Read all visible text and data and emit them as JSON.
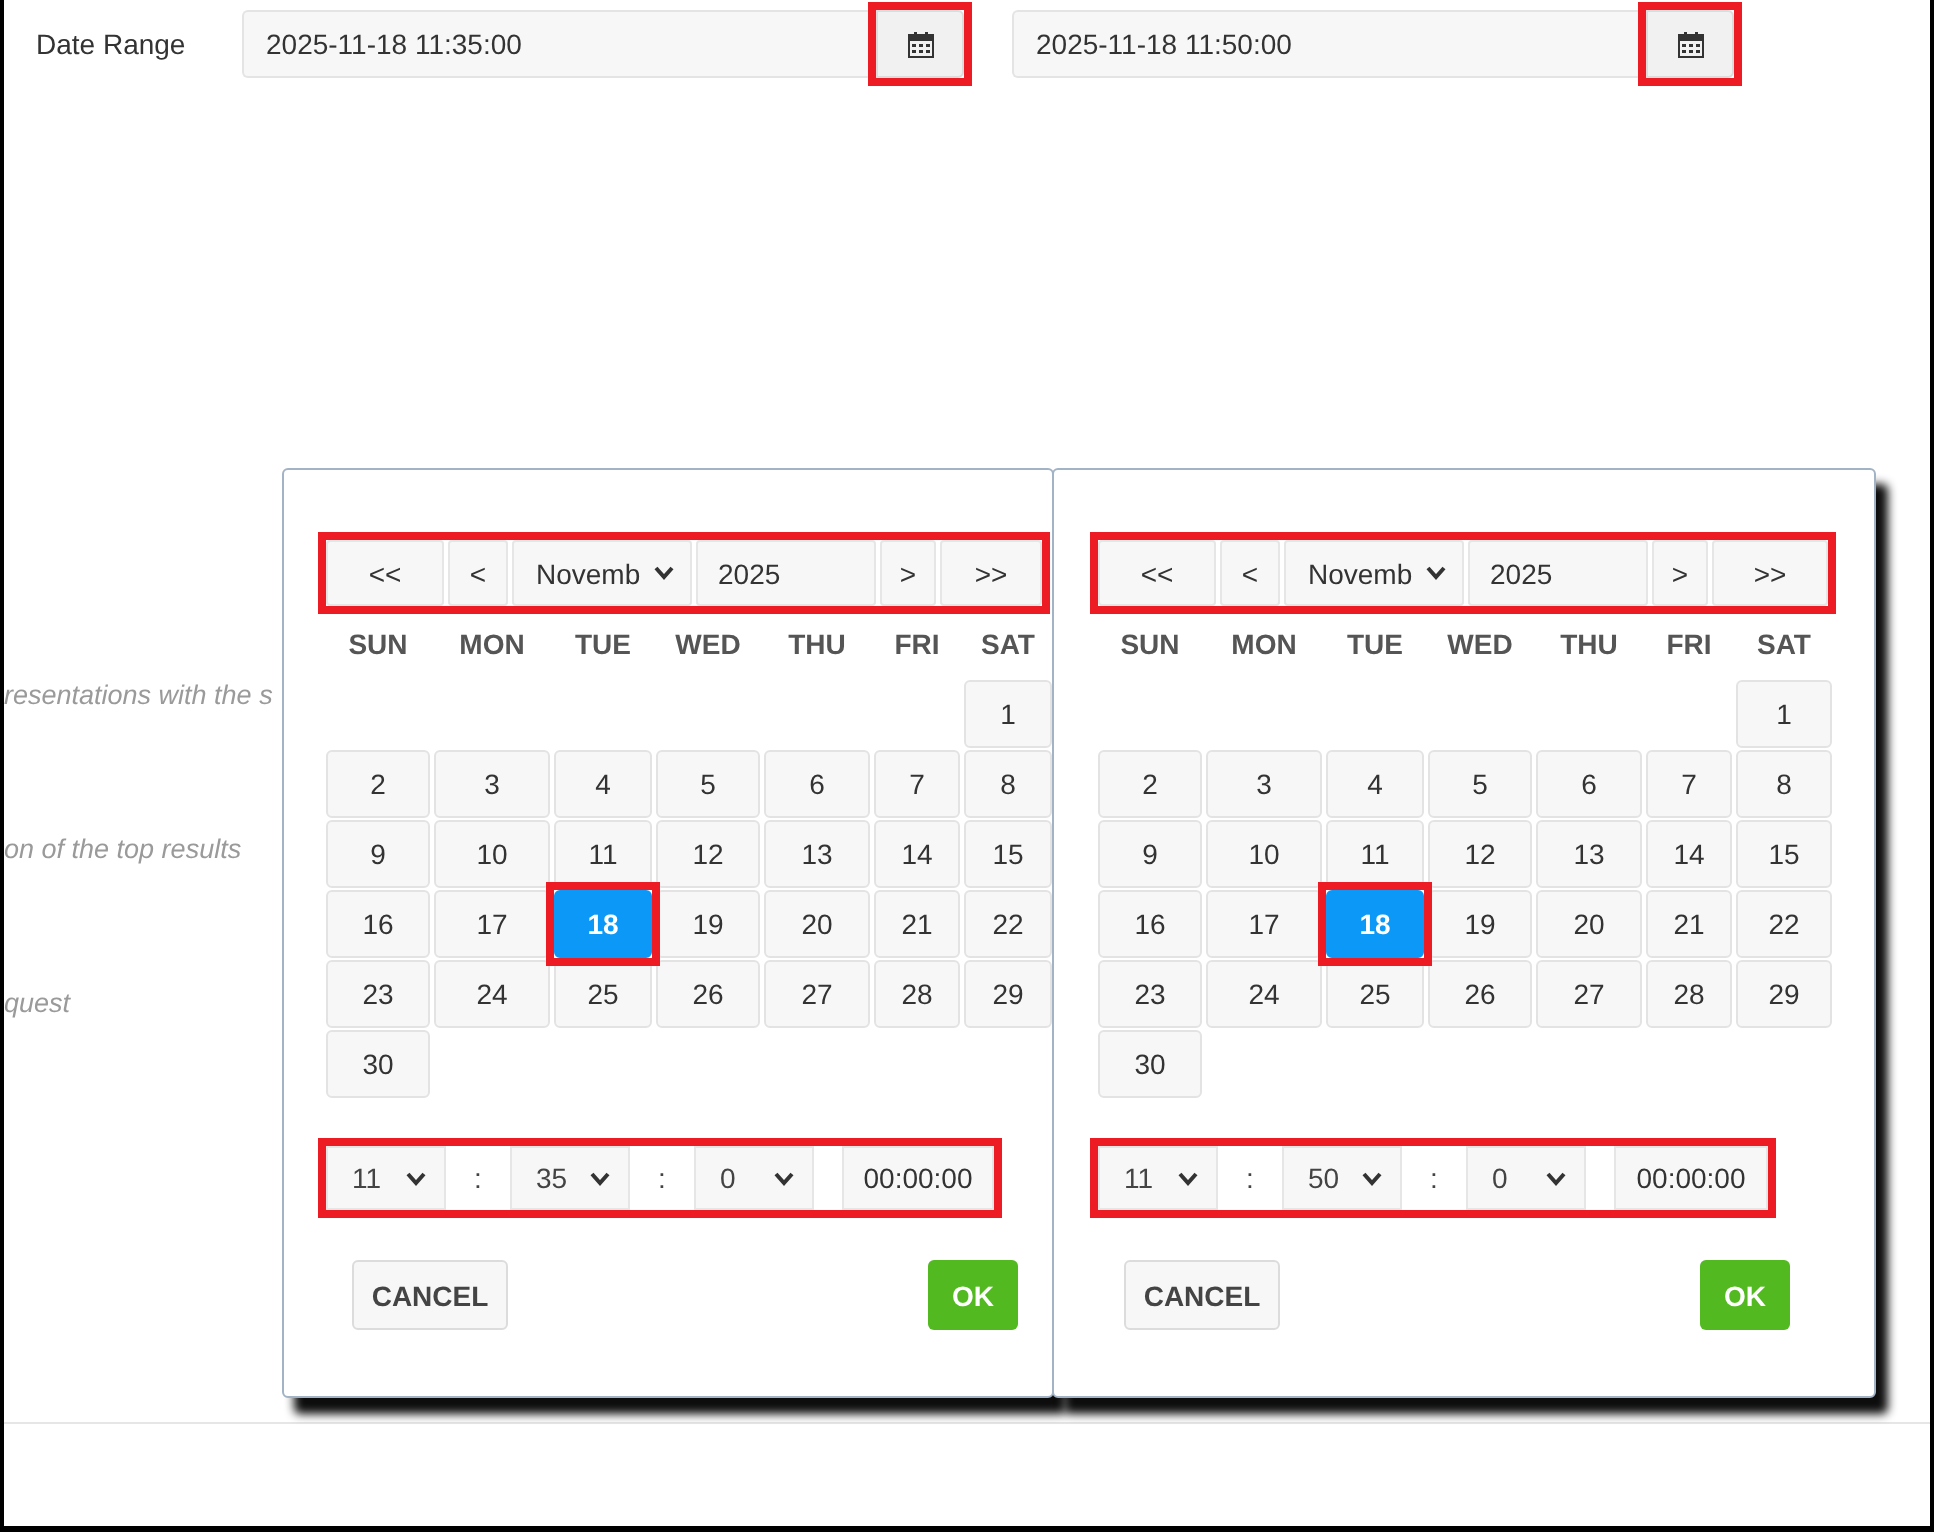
{
  "date_range": {
    "label": "Date Range",
    "fields": [
      {
        "value": "2025-11-18 11:35:00",
        "button_highlighted": true
      },
      {
        "value": "2025-11-18 11:50:00",
        "button_highlighted": true
      }
    ]
  },
  "background_notes": [
    "resentations with the s",
    "on of the top results",
    "quest"
  ],
  "pickers": [
    {
      "nav": {
        "prev_year": "<<",
        "prev_month": "<",
        "month": "Novemb",
        "year": "2025",
        "next_month": ">",
        "next_year": ">>",
        "highlighted": true
      },
      "weekdays": [
        "SUN",
        "MON",
        "TUE",
        "WED",
        "THU",
        "FRI",
        "SAT"
      ],
      "days": [
        {
          "kind": "blank"
        },
        {
          "kind": "blank"
        },
        {
          "kind": "blank"
        },
        {
          "kind": "blank"
        },
        {
          "kind": "blank"
        },
        {
          "kind": "blank"
        },
        {
          "kind": "day",
          "label": "1",
          "selected": false,
          "highlighted": false
        },
        {
          "kind": "day",
          "label": "2",
          "selected": false,
          "highlighted": false
        },
        {
          "kind": "day",
          "label": "3",
          "selected": false,
          "highlighted": false
        },
        {
          "kind": "day",
          "label": "4",
          "selected": false,
          "highlighted": false
        },
        {
          "kind": "day",
          "label": "5",
          "selected": false,
          "highlighted": false
        },
        {
          "kind": "day",
          "label": "6",
          "selected": false,
          "highlighted": false
        },
        {
          "kind": "day",
          "label": "7",
          "selected": false,
          "highlighted": false
        },
        {
          "kind": "day",
          "label": "8",
          "selected": false,
          "highlighted": false
        },
        {
          "kind": "day",
          "label": "9",
          "selected": false,
          "highlighted": false
        },
        {
          "kind": "day",
          "label": "10",
          "selected": false,
          "highlighted": false
        },
        {
          "kind": "day",
          "label": "11",
          "selected": false,
          "highlighted": false
        },
        {
          "kind": "day",
          "label": "12",
          "selected": false,
          "highlighted": false
        },
        {
          "kind": "day",
          "label": "13",
          "selected": false,
          "highlighted": false
        },
        {
          "kind": "day",
          "label": "14",
          "selected": false,
          "highlighted": false
        },
        {
          "kind": "day",
          "label": "15",
          "selected": false,
          "highlighted": false
        },
        {
          "kind": "day",
          "label": "16",
          "selected": false,
          "highlighted": false
        },
        {
          "kind": "day",
          "label": "17",
          "selected": false,
          "highlighted": false
        },
        {
          "kind": "day",
          "label": "18",
          "selected": true,
          "highlighted": true
        },
        {
          "kind": "day",
          "label": "19",
          "selected": false,
          "highlighted": false
        },
        {
          "kind": "day",
          "label": "20",
          "selected": false,
          "highlighted": false
        },
        {
          "kind": "day",
          "label": "21",
          "selected": false,
          "highlighted": false
        },
        {
          "kind": "day",
          "label": "22",
          "selected": false,
          "highlighted": false
        },
        {
          "kind": "day",
          "label": "23",
          "selected": false,
          "highlighted": false
        },
        {
          "kind": "day",
          "label": "24",
          "selected": false,
          "highlighted": false
        },
        {
          "kind": "day",
          "label": "25",
          "selected": false,
          "highlighted": false
        },
        {
          "kind": "day",
          "label": "26",
          "selected": false,
          "highlighted": false
        },
        {
          "kind": "day",
          "label": "27",
          "selected": false,
          "highlighted": false
        },
        {
          "kind": "day",
          "label": "28",
          "selected": false,
          "highlighted": false
        },
        {
          "kind": "day",
          "label": "29",
          "selected": false,
          "highlighted": false
        },
        {
          "kind": "day",
          "label": "30",
          "selected": false,
          "highlighted": false
        }
      ],
      "time": {
        "hour": "11",
        "separator_1": ":",
        "minute": "35",
        "separator_2": ":",
        "second": "0",
        "display": "00:00:00",
        "highlighted": true
      },
      "buttons": {
        "cancel": "CANCEL",
        "ok": "OK"
      }
    },
    {
      "nav": {
        "prev_year": "<<",
        "prev_month": "<",
        "month": "Novemb",
        "year": "2025",
        "next_month": ">",
        "next_year": ">>",
        "highlighted": true
      },
      "weekdays": [
        "SUN",
        "MON",
        "TUE",
        "WED",
        "THU",
        "FRI",
        "SAT"
      ],
      "days": [
        {
          "kind": "blank"
        },
        {
          "kind": "blank"
        },
        {
          "kind": "blank"
        },
        {
          "kind": "blank"
        },
        {
          "kind": "blank"
        },
        {
          "kind": "blank"
        },
        {
          "kind": "day",
          "label": "1",
          "selected": false,
          "highlighted": false
        },
        {
          "kind": "day",
          "label": "2",
          "selected": false,
          "highlighted": false
        },
        {
          "kind": "day",
          "label": "3",
          "selected": false,
          "highlighted": false
        },
        {
          "kind": "day",
          "label": "4",
          "selected": false,
          "highlighted": false
        },
        {
          "kind": "day",
          "label": "5",
          "selected": false,
          "highlighted": false
        },
        {
          "kind": "day",
          "label": "6",
          "selected": false,
          "highlighted": false
        },
        {
          "kind": "day",
          "label": "7",
          "selected": false,
          "highlighted": false
        },
        {
          "kind": "day",
          "label": "8",
          "selected": false,
          "highlighted": false
        },
        {
          "kind": "day",
          "label": "9",
          "selected": false,
          "highlighted": false
        },
        {
          "kind": "day",
          "label": "10",
          "selected": false,
          "highlighted": false
        },
        {
          "kind": "day",
          "label": "11",
          "selected": false,
          "highlighted": false
        },
        {
          "kind": "day",
          "label": "12",
          "selected": false,
          "highlighted": false
        },
        {
          "kind": "day",
          "label": "13",
          "selected": false,
          "highlighted": false
        },
        {
          "kind": "day",
          "label": "14",
          "selected": false,
          "highlighted": false
        },
        {
          "kind": "day",
          "label": "15",
          "selected": false,
          "highlighted": false
        },
        {
          "kind": "day",
          "label": "16",
          "selected": false,
          "highlighted": false
        },
        {
          "kind": "day",
          "label": "17",
          "selected": false,
          "highlighted": false
        },
        {
          "kind": "day",
          "label": "18",
          "selected": true,
          "highlighted": true
        },
        {
          "kind": "day",
          "label": "19",
          "selected": false,
          "highlighted": false
        },
        {
          "kind": "day",
          "label": "20",
          "selected": false,
          "highlighted": false
        },
        {
          "kind": "day",
          "label": "21",
          "selected": false,
          "highlighted": false
        },
        {
          "kind": "day",
          "label": "22",
          "selected": false,
          "highlighted": false
        },
        {
          "kind": "day",
          "label": "23",
          "selected": false,
          "highlighted": false
        },
        {
          "kind": "day",
          "label": "24",
          "selected": false,
          "highlighted": false
        },
        {
          "kind": "day",
          "label": "25",
          "selected": false,
          "highlighted": false
        },
        {
          "kind": "day",
          "label": "26",
          "selected": false,
          "highlighted": false
        },
        {
          "kind": "day",
          "label": "27",
          "selected": false,
          "highlighted": false
        },
        {
          "kind": "day",
          "label": "28",
          "selected": false,
          "highlighted": false
        },
        {
          "kind": "day",
          "label": "29",
          "selected": false,
          "highlighted": false
        },
        {
          "kind": "day",
          "label": "30",
          "selected": false,
          "highlighted": false
        }
      ],
      "time": {
        "hour": "11",
        "separator_1": ":",
        "minute": "50",
        "separator_2": ":",
        "second": "0",
        "display": "00:00:00",
        "highlighted": true
      },
      "buttons": {
        "cancel": "CANCEL",
        "ok": "OK"
      }
    }
  ]
}
